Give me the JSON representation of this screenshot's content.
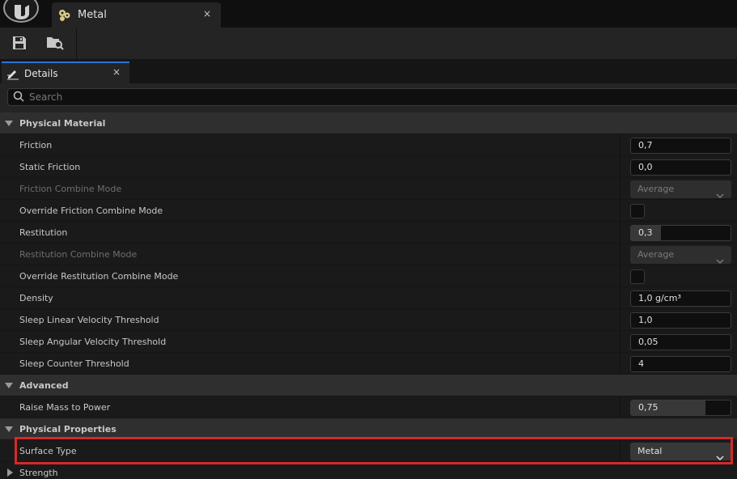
{
  "titlebar": {
    "logo": "unreal-engine-logo",
    "tab_title": "Metal",
    "tab_icon": "physical-material-icon",
    "tab_close": "×"
  },
  "toolbar": {
    "buttons": [
      {
        "icon": "save-icon"
      },
      {
        "icon": "browse-asset-icon"
      }
    ]
  },
  "details_tab": {
    "title": "Details",
    "icon": "details-pencil-icon",
    "close": "×"
  },
  "search": {
    "placeholder": "Search"
  },
  "colors": {
    "highlight": "#d42a2a",
    "accent": "#2a74d6"
  },
  "sections": [
    {
      "category": "Physical Material",
      "expanded": true,
      "properties": [
        {
          "label": "Friction",
          "kind": "number",
          "value": "0,7"
        },
        {
          "label": "Static Friction",
          "kind": "number",
          "value": "0,0"
        },
        {
          "label": "Friction Combine Mode",
          "kind": "combo",
          "value": "Average",
          "disabled": true
        },
        {
          "label": "Override Friction Combine Mode",
          "kind": "checkbox",
          "checked": false
        },
        {
          "label": "Restitution",
          "kind": "slider",
          "value": "0,3",
          "fill": 0.3
        },
        {
          "label": "Restitution Combine Mode",
          "kind": "combo",
          "value": "Average",
          "disabled": true
        },
        {
          "label": "Override Restitution Combine Mode",
          "kind": "checkbox",
          "checked": false
        },
        {
          "label": "Density",
          "kind": "number",
          "value": "1,0 g/cm³"
        },
        {
          "label": "Sleep Linear Velocity Threshold",
          "kind": "number",
          "value": "1,0"
        },
        {
          "label": "Sleep Angular Velocity Threshold",
          "kind": "number",
          "value": "0,05"
        },
        {
          "label": "Sleep Counter Threshold",
          "kind": "number",
          "value": "4"
        }
      ]
    },
    {
      "category": "Advanced",
      "expanded": true,
      "properties": [
        {
          "label": "Raise Mass to Power",
          "kind": "slider",
          "value": "0,75",
          "fill": 0.75
        }
      ]
    },
    {
      "category": "Physical Properties",
      "expanded": true,
      "properties": [
        {
          "label": "Surface Type",
          "kind": "combo",
          "value": "Metal",
          "disabled": false,
          "highlighted": true
        },
        {
          "label": "Strength",
          "kind": "group",
          "collapsed": true
        }
      ]
    }
  ]
}
